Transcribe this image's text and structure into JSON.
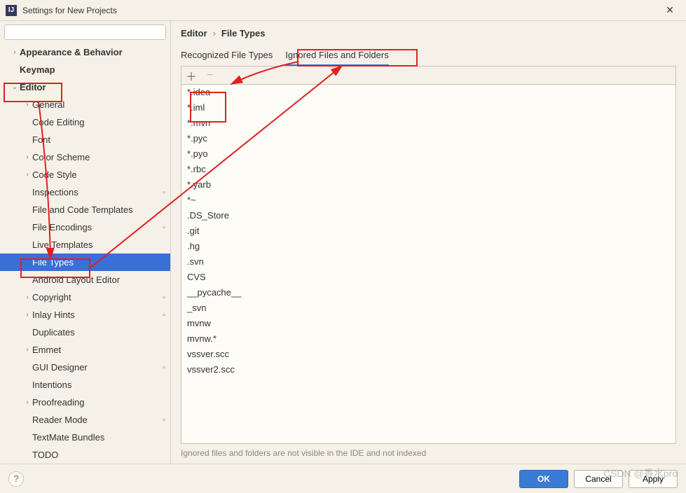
{
  "window": {
    "title": "Settings for New Projects"
  },
  "search": {
    "placeholder": ""
  },
  "breadcrumb": {
    "part1": "Editor",
    "sep": "›",
    "part2": "File Types"
  },
  "tabs": {
    "recognized": "Recognized File Types",
    "ignored": "Ignored Files and Folders"
  },
  "tree": [
    {
      "label": "Appearance & Behavior",
      "depth": 1,
      "chev": "›",
      "bold": true
    },
    {
      "label": "Keymap",
      "depth": 1,
      "chev": "",
      "bold": true
    },
    {
      "label": "Editor",
      "depth": 1,
      "chev": "⌄",
      "bold": true
    },
    {
      "label": "General",
      "depth": 2,
      "chev": "›"
    },
    {
      "label": "Code Editing",
      "depth": 2,
      "chev": ""
    },
    {
      "label": "Font",
      "depth": 2,
      "chev": ""
    },
    {
      "label": "Color Scheme",
      "depth": 2,
      "chev": "›"
    },
    {
      "label": "Code Style",
      "depth": 2,
      "chev": "›"
    },
    {
      "label": "Inspections",
      "depth": 2,
      "chev": "",
      "ext": true
    },
    {
      "label": "File and Code Templates",
      "depth": 2,
      "chev": ""
    },
    {
      "label": "File Encodings",
      "depth": 2,
      "chev": "",
      "ext": true
    },
    {
      "label": "Live Templates",
      "depth": 2,
      "chev": ""
    },
    {
      "label": "File Types",
      "depth": 2,
      "chev": "",
      "selected": true
    },
    {
      "label": "Android Layout Editor",
      "depth": 2,
      "chev": ""
    },
    {
      "label": "Copyright",
      "depth": 2,
      "chev": "›",
      "ext": true
    },
    {
      "label": "Inlay Hints",
      "depth": 2,
      "chev": "›",
      "ext": true
    },
    {
      "label": "Duplicates",
      "depth": 2,
      "chev": ""
    },
    {
      "label": "Emmet",
      "depth": 2,
      "chev": "›"
    },
    {
      "label": "GUI Designer",
      "depth": 2,
      "chev": "",
      "ext": true
    },
    {
      "label": "Intentions",
      "depth": 2,
      "chev": ""
    },
    {
      "label": "Proofreading",
      "depth": 2,
      "chev": "›"
    },
    {
      "label": "Reader Mode",
      "depth": 2,
      "chev": "",
      "ext": true
    },
    {
      "label": "TextMate Bundles",
      "depth": 2,
      "chev": ""
    },
    {
      "label": "TODO",
      "depth": 2,
      "chev": ""
    }
  ],
  "patterns": [
    "*.idea",
    "*.iml",
    "*.mvn",
    "*.pyc",
    "*.pyo",
    "*.rbc",
    "*.yarb",
    "*~",
    ".DS_Store",
    ".git",
    ".hg",
    ".svn",
    "CVS",
    "__pycache__",
    "_svn",
    "mvnw",
    "mvnw.*",
    "vssver.scc",
    "vssver2.scc"
  ],
  "hint": "Ignored files and folders are not visible in the IDE and not indexed",
  "buttons": {
    "ok": "OK",
    "cancel": "Cancel",
    "apply": "Apply"
  },
  "appIcon": "IJ",
  "watermark": "CSDN @香水pro"
}
